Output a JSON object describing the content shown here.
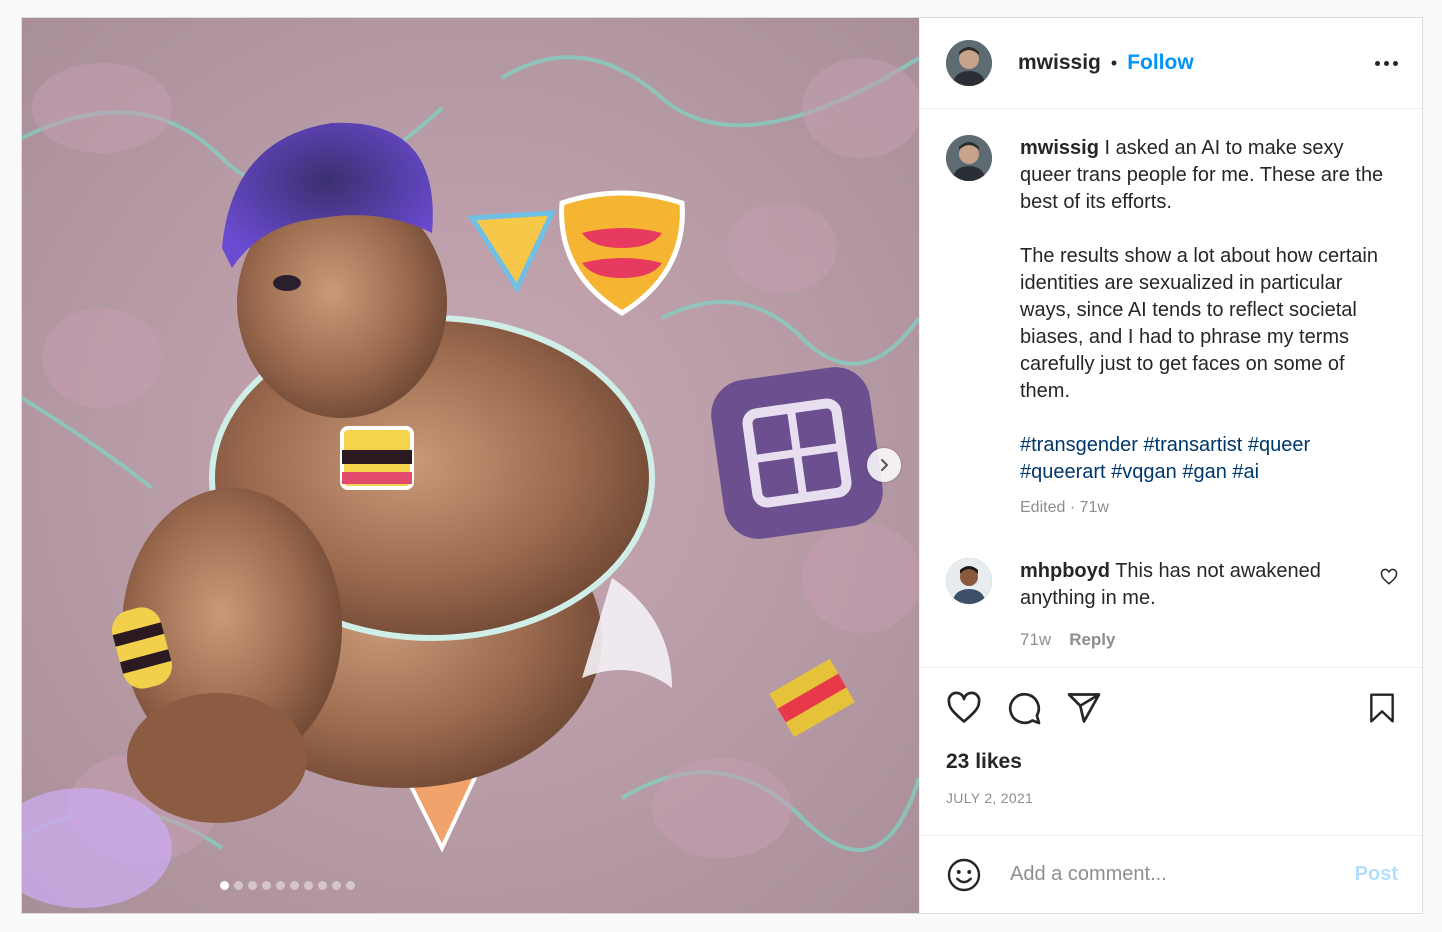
{
  "post": {
    "header": {
      "username": "mwissig",
      "separator": "•",
      "follow_label": "Follow",
      "more_icon": "more-horizontal-icon"
    },
    "media": {
      "carousel_count": 10,
      "active_index": 0,
      "next_icon": "chevron-right-icon"
    },
    "caption": {
      "username": "mwissig",
      "text1": "I asked an AI to make sexy queer trans people for me. These are the best of its efforts.",
      "text2": "The results show a lot about how certain identities are sexualized in particular ways, since AI tends to reflect societal biases, and I had to phrase my terms carefully just to get faces on some of them.",
      "hashtags": "#transgender #transartist #queer #queerart #vqgan #gan #ai",
      "meta": "Edited · 71w"
    },
    "comment": {
      "username": "mhpboyd",
      "text": "This has not awakened anything in me.",
      "time": "71w",
      "reply_label": "Reply",
      "like_icon": "heart-outline-icon"
    },
    "actions": {
      "like_icon": "heart-outline-icon",
      "comment_icon": "comment-bubble-icon",
      "share_icon": "paper-plane-icon",
      "save_icon": "bookmark-icon"
    },
    "likes": "23 likes",
    "date": "JULY 2, 2021",
    "add_comment": {
      "emoji_icon": "emoji-smile-icon",
      "placeholder": "Add a comment...",
      "post_label": "Post"
    },
    "colors": {
      "link": "#0095f6",
      "hashtag": "#00376b",
      "muted": "#8e8e8e",
      "post_disabled": "#b2dffc"
    }
  }
}
